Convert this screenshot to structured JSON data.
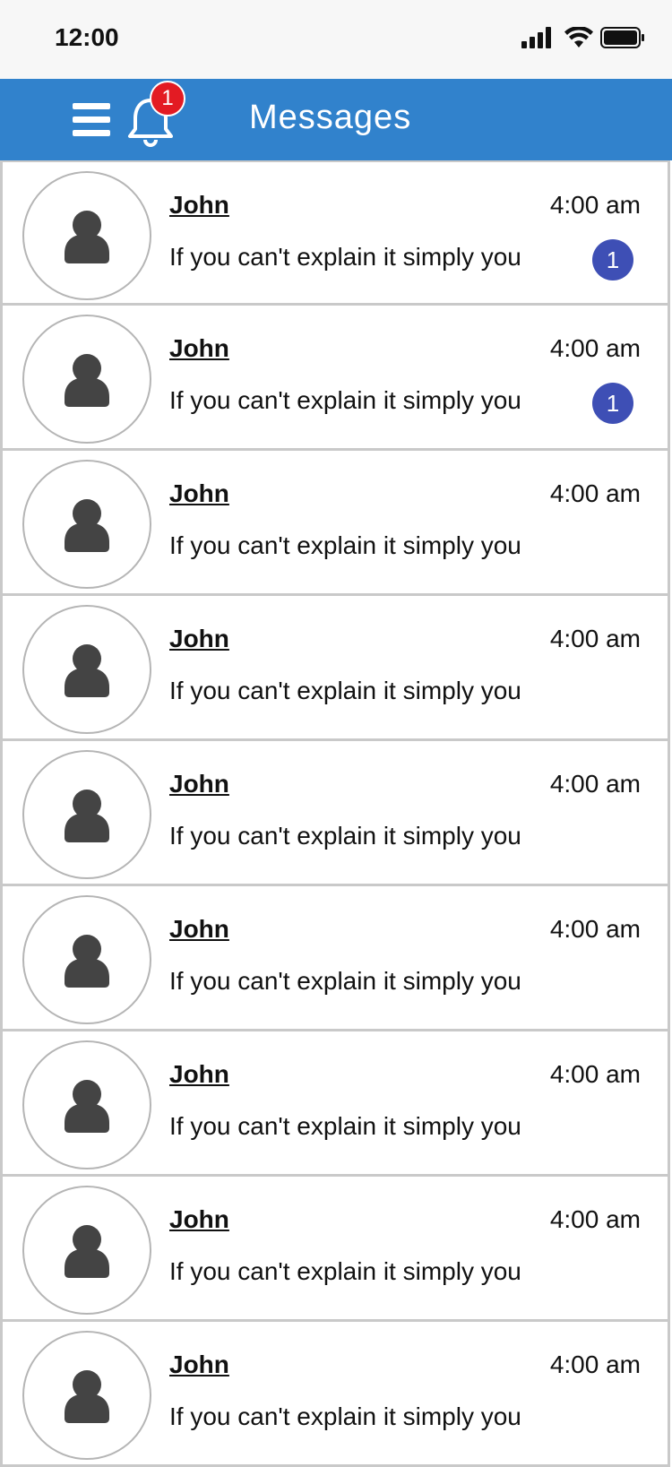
{
  "status_bar": {
    "time": "12:00"
  },
  "header": {
    "title": "Messages",
    "notification_count": "1",
    "menu_icon": "hamburger-menu-icon",
    "bell_icon": "bell-icon"
  },
  "colors": {
    "header_bg": "#3182cc",
    "notification_badge": "#e31b23",
    "unread_badge": "#3e4fb5",
    "avatar_figure": "#444444",
    "row_border": "#c9c9c9"
  },
  "messages": [
    {
      "name": "John",
      "time": "4:00 am",
      "preview": "If you can't explain it simply you",
      "unread": "1"
    },
    {
      "name": "John",
      "time": "4:00 am",
      "preview": "If you can't explain it simply you",
      "unread": "1"
    },
    {
      "name": "John",
      "time": "4:00 am",
      "preview": "If you can't explain it simply you",
      "unread": null
    },
    {
      "name": "John",
      "time": "4:00 am",
      "preview": "If you can't explain it simply you",
      "unread": null
    },
    {
      "name": "John",
      "time": "4:00 am",
      "preview": "If you can't explain it simply you",
      "unread": null
    },
    {
      "name": "John",
      "time": "4:00 am",
      "preview": "If you can't explain it simply you",
      "unread": null
    },
    {
      "name": "John",
      "time": "4:00 am",
      "preview": "If you can't explain it simply you",
      "unread": null
    },
    {
      "name": "John",
      "time": "4:00 am",
      "preview": "If you can't explain it simply you",
      "unread": null
    },
    {
      "name": "John",
      "time": "4:00 am",
      "preview": "If you can't explain it simply you",
      "unread": null
    }
  ]
}
